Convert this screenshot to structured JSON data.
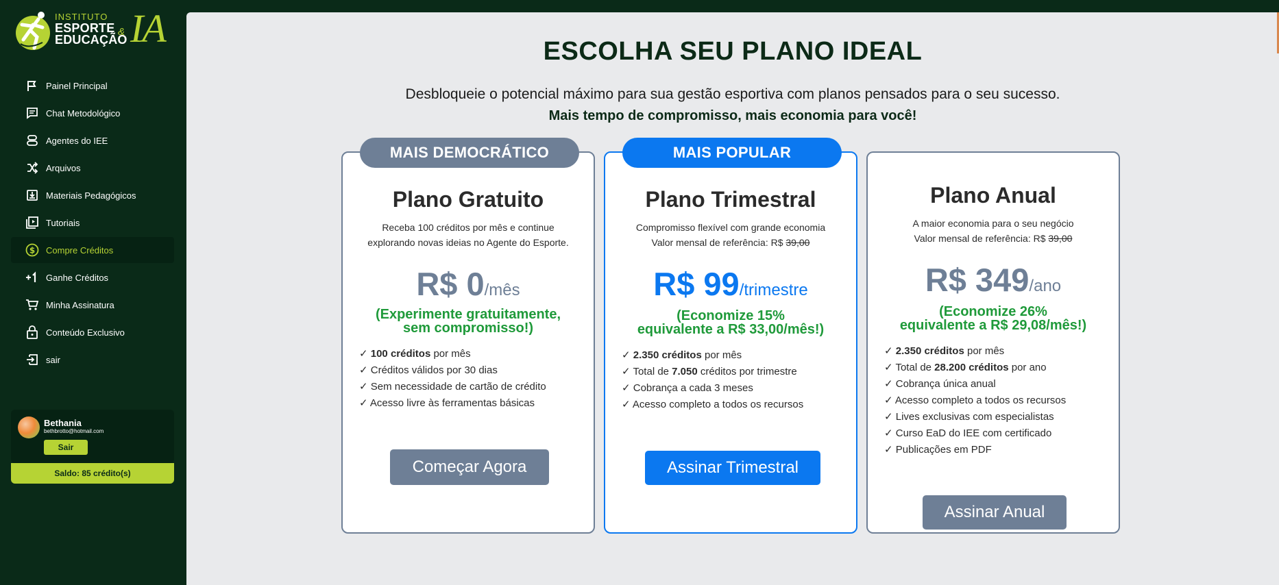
{
  "brand": {
    "line1": "INSTITUTO",
    "line2": "ESPORTE",
    "line3": "EDUCAÇÃO",
    "amp": "&",
    "ia": "IA",
    "accent_color": "#b6d334",
    "sidebar_color": "#0a2a18"
  },
  "sidebar": {
    "items": [
      {
        "label": "Painel Principal",
        "icon": "flag-icon"
      },
      {
        "label": "Chat Metodológico",
        "icon": "chat-icon"
      },
      {
        "label": "Agentes do IEE",
        "icon": "agents-icon"
      },
      {
        "label": "Arquivos",
        "icon": "shuffle-icon"
      },
      {
        "label": "Materiais Pedagógicos",
        "icon": "download-box-icon"
      },
      {
        "label": "Tutoriais",
        "icon": "video-library-icon"
      },
      {
        "label": "Compre Créditos",
        "icon": "dollar-circle-icon",
        "active": true
      },
      {
        "label": "Ganhe Créditos",
        "icon": "plus-one-icon"
      },
      {
        "label": "Minha Assinatura",
        "icon": "cart-icon"
      },
      {
        "label": "Conteúdo Exclusivo",
        "icon": "lock-icon"
      },
      {
        "label": "sair",
        "icon": "logout-icon"
      }
    ],
    "user": {
      "name": "Bethania",
      "email": "bethbrotto@hotmail.com",
      "logout_label": "Sair",
      "balance": "Saldo: 85 crédito(s)"
    }
  },
  "main": {
    "title": "ESCOLHA SEU PLANO IDEAL",
    "subtitle": "Desbloqueie o potencial máximo para sua gestão esportiva com planos pensados para o seu sucesso.",
    "subtitle_bold": "Mais tempo de compromisso, mais economia para você!"
  },
  "plans": [
    {
      "badge": "MAIS DEMOCRÁTICO",
      "badge_color": "#6e7f96",
      "name": "Plano Gratuito",
      "desc_line1": "Receba 100 créditos por mês e continue",
      "desc_line2": "explorando novas ideias no Agente do Esporte.",
      "price": "R$ 0",
      "period": "/mês",
      "promo_line1": "(Experimente gratuitamente,",
      "promo_line2": "sem compromisso!)",
      "features": [
        {
          "pre": "✓ ",
          "bold": "100 créditos",
          "post": " por mês"
        },
        {
          "pre": "✓ Créditos válidos por 30 dias",
          "bold": "",
          "post": ""
        },
        {
          "pre": "✓ Sem necessidade de cartão de crédito",
          "bold": "",
          "post": ""
        },
        {
          "pre": "✓ Acesso livre às ferramentas básicas",
          "bold": "",
          "post": ""
        }
      ],
      "cta": "Começar Agora"
    },
    {
      "badge": "MAIS POPULAR",
      "badge_color": "#0b78f0",
      "name": "Plano Trimestral",
      "desc_line1": "Compromisso flexível com grande economia",
      "desc_ref": "Valor mensal de referência: R$ ",
      "desc_ref_strike": "39,00",
      "price": "R$ 99",
      "period": "/trimestre",
      "promo_line1": "(Economize 15%",
      "promo_line2": "equivalente a R$ 33,00/mês!)",
      "features": [
        {
          "pre": "✓ ",
          "bold": "2.350 créditos",
          "post": " por mês"
        },
        {
          "pre": "✓ Total de ",
          "bold": "7.050",
          "post": " créditos por trimestre"
        },
        {
          "pre": "✓ Cobrança a cada 3 meses",
          "bold": "",
          "post": ""
        },
        {
          "pre": "✓ Acesso completo a todos os recursos",
          "bold": "",
          "post": ""
        }
      ],
      "cta": "Assinar Trimestral"
    },
    {
      "name": "Plano Anual",
      "desc_line1": "A maior economia para o seu negócio",
      "desc_ref": "Valor mensal de referência: R$ ",
      "desc_ref_strike": "39,00",
      "price": "R$ 349",
      "period": "/ano",
      "promo_line1": "(Economize 26%",
      "promo_line2": "equivalente a R$ 29,08/mês!)",
      "features": [
        {
          "pre": "✓ ",
          "bold": "2.350 créditos",
          "post": " por mês"
        },
        {
          "pre": "✓ Total de ",
          "bold": "28.200 créditos",
          "post": " por ano"
        },
        {
          "pre": "✓ Cobrança única anual",
          "bold": "",
          "post": ""
        },
        {
          "pre": "✓ Acesso completo a todos os recursos",
          "bold": "",
          "post": ""
        },
        {
          "pre": "✓ Lives exclusivas com especialistas",
          "bold": "",
          "post": ""
        },
        {
          "pre": "✓ Curso EaD do IEE com certificado",
          "bold": "",
          "post": ""
        },
        {
          "pre": "✓ Publicações em PDF",
          "bold": "",
          "post": ""
        }
      ],
      "cta": "Assinar Anual"
    }
  ]
}
